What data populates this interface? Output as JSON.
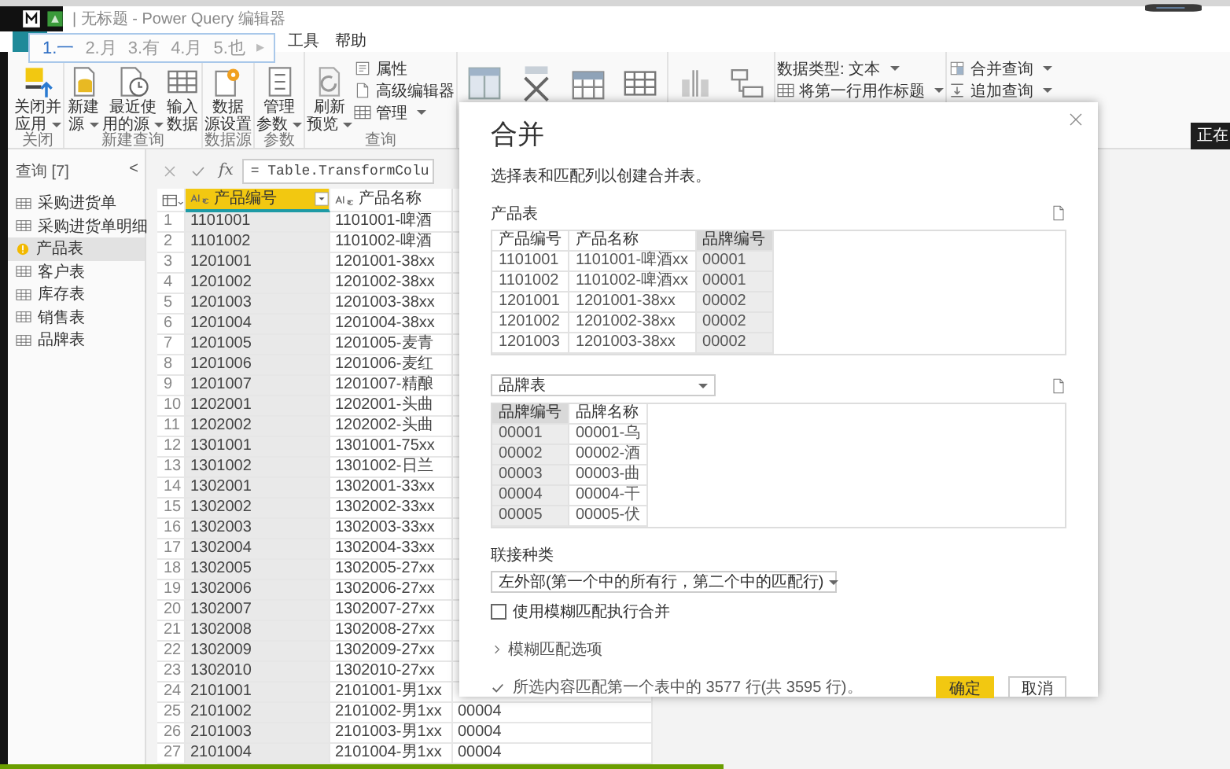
{
  "window": {
    "title": "| 无标题 - Power Query 编辑器"
  },
  "ime": {
    "candidates": [
      {
        "text": "1.一",
        "selected": true
      },
      {
        "text": "2.月",
        "selected": false
      },
      {
        "text": "3.有",
        "selected": false
      },
      {
        "text": "4.月",
        "selected": false
      },
      {
        "text": "5.也",
        "selected": false
      }
    ],
    "next": "▸"
  },
  "tabs": [
    {
      "label": "工具",
      "selected": false
    },
    {
      "label": "帮助",
      "selected": false
    }
  ],
  "ribbon": {
    "groups": [
      {
        "label": "关闭",
        "buttons": [
          {
            "kind": "large",
            "lines": [
              "关闭并",
              "应用"
            ],
            "dropdown": true
          }
        ]
      },
      {
        "label": "新建查询",
        "buttons": [
          {
            "kind": "large",
            "lines": [
              "新建",
              "源"
            ],
            "dropdown": true
          },
          {
            "kind": "large",
            "lines": [
              "最近使",
              "用的源"
            ],
            "dropdown": true
          },
          {
            "kind": "large",
            "lines": [
              "输入",
              "数据"
            ],
            "dropdown": false
          }
        ]
      },
      {
        "label": "数据源",
        "buttons": [
          {
            "kind": "large",
            "lines": [
              "数据",
              "源设置"
            ],
            "dropdown": false
          }
        ]
      },
      {
        "label": "参数",
        "buttons": [
          {
            "kind": "large",
            "lines": [
              "管理",
              "参数"
            ],
            "dropdown": true
          }
        ]
      },
      {
        "label": "查询",
        "buttons": [
          {
            "kind": "large",
            "lines": [
              "刷新",
              "预览"
            ],
            "dropdown": true
          },
          {
            "kind": "small",
            "label": "属性",
            "dropdown": false
          },
          {
            "kind": "small",
            "label": "高级编辑器",
            "dropdown": false
          },
          {
            "kind": "small",
            "label": "管理",
            "dropdown": true
          }
        ]
      },
      {
        "buttons": [
          {
            "kind": "icon"
          },
          {
            "kind": "icon"
          },
          {
            "kind": "icon"
          },
          {
            "kind": "icon"
          }
        ]
      },
      {
        "buttons": [
          {
            "kind": "icon"
          },
          {
            "kind": "icon"
          }
        ]
      },
      {
        "buttons": [
          {
            "kind": "small",
            "label": "数据类型: 文本",
            "dropdown": true
          },
          {
            "kind": "small",
            "label": "将第一行用作标题",
            "dropdown": true
          }
        ]
      },
      {
        "buttons": [
          {
            "kind": "small",
            "label": "合并查询",
            "dropdown": true
          },
          {
            "kind": "small",
            "label": "追加查询",
            "dropdown": true
          }
        ]
      }
    ]
  },
  "tooltip": "正在",
  "queries": {
    "title": "查询 [7]",
    "collapse": "<",
    "items": [
      {
        "name": "采购进货单",
        "kind": "table",
        "selected": false
      },
      {
        "name": "采购进货单明细",
        "kind": "table",
        "selected": false
      },
      {
        "name": "产品表",
        "kind": "warning",
        "selected": true
      },
      {
        "name": "客户表",
        "kind": "table",
        "selected": false
      },
      {
        "name": "库存表",
        "kind": "table",
        "selected": false
      },
      {
        "name": "销售表",
        "kind": "table",
        "selected": false
      },
      {
        "name": "品牌表",
        "kind": "table",
        "selected": false
      }
    ]
  },
  "formula_bar": {
    "fx": "fx",
    "formula": "= Table.TransformColu"
  },
  "grid": {
    "columns": [
      {
        "name": "产品编号",
        "selected": true
      },
      {
        "name": "产品名称",
        "selected": false
      }
    ],
    "rows": [
      {
        "number": "1",
        "cells": [
          "1101001",
          "1101001-啤酒"
        ]
      },
      {
        "number": "2",
        "cells": [
          "1101002",
          "1101002-啤酒"
        ]
      },
      {
        "number": "3",
        "cells": [
          "1201001",
          "1201001-38xx"
        ]
      },
      {
        "number": "4",
        "cells": [
          "1201002",
          "1201002-38xx"
        ]
      },
      {
        "number": "5",
        "cells": [
          "1201003",
          "1201003-38xx"
        ]
      },
      {
        "number": "6",
        "cells": [
          "1201004",
          "1201004-38xx"
        ]
      },
      {
        "number": "7",
        "cells": [
          "1201005",
          "1201005-麦青"
        ]
      },
      {
        "number": "8",
        "cells": [
          "1201006",
          "1201006-麦红"
        ]
      },
      {
        "number": "9",
        "cells": [
          "1201007",
          "1201007-精酿"
        ]
      },
      {
        "number": "10",
        "cells": [
          "1202001",
          "1202001-头曲"
        ]
      },
      {
        "number": "11",
        "cells": [
          "1202002",
          "1202002-头曲"
        ]
      },
      {
        "number": "12",
        "cells": [
          "1301001",
          "1301001-75xx"
        ]
      },
      {
        "number": "13",
        "cells": [
          "1301002",
          "1301002-日兰"
        ]
      },
      {
        "number": "14",
        "cells": [
          "1302001",
          "1302001-33xx"
        ]
      },
      {
        "number": "15",
        "cells": [
          "1302002",
          "1302002-33xx"
        ]
      },
      {
        "number": "16",
        "cells": [
          "1302003",
          "1302003-33xx"
        ]
      },
      {
        "number": "17",
        "cells": [
          "1302004",
          "1302004-33xx"
        ]
      },
      {
        "number": "18",
        "cells": [
          "1302005",
          "1302005-27xx"
        ]
      },
      {
        "number": "19",
        "cells": [
          "1302006",
          "1302006-27xx"
        ]
      },
      {
        "number": "20",
        "cells": [
          "1302007",
          "1302007-27xx"
        ]
      },
      {
        "number": "21",
        "cells": [
          "1302008",
          "1302008-27xx"
        ]
      },
      {
        "number": "22",
        "cells": [
          "1302009",
          "1302009-27xx"
        ]
      },
      {
        "number": "23",
        "cells": [
          "1302010",
          "1302010-27xx"
        ]
      },
      {
        "number": "24",
        "cells": [
          "2101001",
          "2101001-男1xx"
        ]
      },
      {
        "number": "25",
        "cells": [
          "2101002",
          "2101002-男1xx",
          "00004"
        ]
      },
      {
        "number": "26",
        "cells": [
          "2101003",
          "2101003-男1xx",
          "00004"
        ]
      },
      {
        "number": "27",
        "cells": [
          "2101004",
          "2101004-男1xx",
          "00004"
        ]
      }
    ]
  },
  "dialog": {
    "title": "合并",
    "description": "选择表和匹配列以创建合并表。",
    "first_table": {
      "name": "产品表",
      "columns": [
        {
          "name": "产品编号",
          "selected": false
        },
        {
          "name": "产品名称",
          "selected": false
        },
        {
          "name": "品牌编号",
          "selected": true
        }
      ],
      "rows": [
        [
          "1101001",
          "1101001-啤酒xx",
          "00001"
        ],
        [
          "1101002",
          "1101002-啤酒xx",
          "00001"
        ],
        [
          "1201001",
          "1201001-38xx",
          "00002"
        ],
        [
          "1201002",
          "1201002-38xx",
          "00002"
        ],
        [
          "1201003",
          "1201003-38xx",
          "00002"
        ]
      ]
    },
    "second_table": {
      "dropdown": "品牌表",
      "columns": [
        {
          "name": "品牌编号",
          "selected": true
        },
        {
          "name": "品牌名称",
          "selected": false
        }
      ],
      "rows": [
        [
          "00001",
          "00001-乌"
        ],
        [
          "00002",
          "00002-酒"
        ],
        [
          "00003",
          "00003-曲"
        ],
        [
          "00004",
          "00004-干"
        ],
        [
          "00005",
          "00005-伏"
        ]
      ]
    },
    "join_kind": {
      "label": "联接种类",
      "value": "左外部(第一个中的所有行，第二个中的匹配行)"
    },
    "fuzzy": {
      "label": "使用模糊匹配执行合并",
      "checked": false
    },
    "fuzzy_options": {
      "label": "模糊匹配选项",
      "expanded": false
    },
    "status": "所选内容匹配第一个表中的 3577 行(共 3595 行)。",
    "buttons": [
      {
        "label": "确定",
        "kind": "primary"
      },
      {
        "label": "取消",
        "kind": "secondary"
      }
    ]
  }
}
